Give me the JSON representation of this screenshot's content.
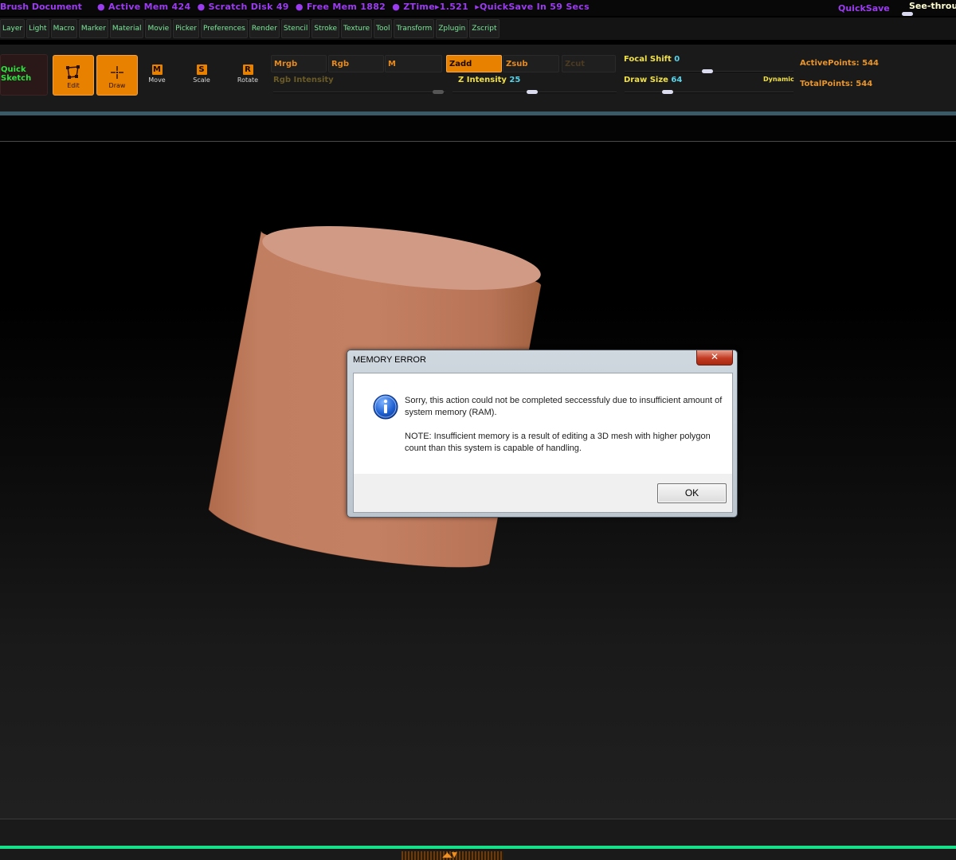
{
  "statusbar": {
    "document": "Brush Document",
    "active_mem": "● Active Mem 424",
    "scratch_disk": "● Scratch Disk 49",
    "free_mem": "● Free Mem 1882",
    "ztime": "● ZTime▸1.521",
    "quicksave_timer": "▸QuickSave In 59 Secs",
    "quicksave": "QuickSave",
    "see_through": "See-throu"
  },
  "menu": [
    "Layer",
    "Light",
    "Macro",
    "Marker",
    "Material",
    "Movie",
    "Picker",
    "Preferences",
    "Render",
    "Stencil",
    "Stroke",
    "Texture",
    "Tool",
    "Transform",
    "Zplugin",
    "Zscript"
  ],
  "toolbar": {
    "quick_sketch_line1": "Quick",
    "quick_sketch_line2": "Sketch",
    "edit": "Edit",
    "draw": "Draw",
    "move": "Move",
    "move_key": "M",
    "scale": "Scale",
    "scale_key": "S",
    "rotate": "Rotate",
    "rotate_key": "R",
    "mrgb": "Mrgb",
    "rgb": "Rgb",
    "m": "M",
    "rgb_intensity": "Rgb Intensity",
    "zadd": "Zadd",
    "zsub": "Zsub",
    "zcut": "Zcut",
    "z_intensity_label": "Z Intensity",
    "z_intensity_value": "25",
    "focal_shift_label": "Focal Shift",
    "focal_shift_value": "0",
    "draw_size_label": "Draw Size",
    "draw_size_value": "64",
    "dynamic": "Dynamic",
    "active_points": "ActivePoints: 544",
    "total_points": "TotalPoints: 544"
  },
  "dialog": {
    "title": "MEMORY ERROR",
    "close": "✕",
    "message": "Sorry, this action could not be completed seccessfuly due to insufficient amount of system memory (RAM).",
    "note": "NOTE: Insufficient memory is a result of editing a 3D mesh with higher polygon count than this system is capable of handling.",
    "ok": "OK"
  },
  "bottom": {
    "arrows": "◢◣▼"
  },
  "colors": {
    "accent": "#e98100",
    "cylinder": "#c07a5c",
    "status_purple": "#9b3cf0",
    "menu_green": "#7de89a",
    "bottom_green": "#17e08a"
  }
}
